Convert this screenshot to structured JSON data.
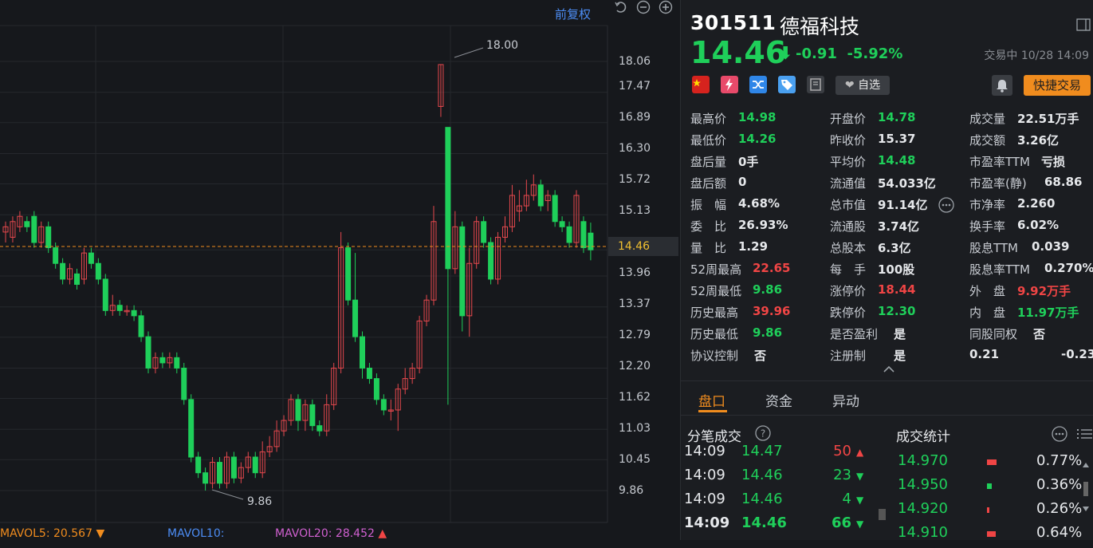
{
  "chart": {
    "restore_label": "前复权",
    "high_tag": "18.00",
    "low_tag": "9.86",
    "price_levels": [
      "18.06",
      "17.47",
      "16.89",
      "16.30",
      "15.72",
      "15.13",
      "14.46",
      "13.96",
      "13.37",
      "12.79",
      "12.20",
      "11.62",
      "11.03",
      "10.45",
      "9.86"
    ],
    "current_price_label": "14.46",
    "mavol": [
      {
        "label": "MAVOL5:",
        "value": "20.567",
        "color": "#f08c1e"
      },
      {
        "label": "MAVOL10:",
        "value": "",
        "color": "#4c8df5"
      },
      {
        "label": "MAVOL20:",
        "value": "28.452",
        "color": "#d060d0"
      }
    ]
  },
  "stock": {
    "code": "301511",
    "name": "德福科技",
    "price": "14.46",
    "change": "-0.91",
    "change_pct": "-5.92%",
    "status": "交易中 10/28 14:09",
    "watchlist_label": "自选",
    "quick_trade_label": "快捷交易"
  },
  "quote_cols": [
    [
      {
        "label": "最高价",
        "value": "14.98",
        "cls": "dn"
      },
      {
        "label": "最低价",
        "value": "14.26",
        "cls": "dn"
      },
      {
        "label": "盘后量",
        "value": "0手",
        "cls": "wh"
      },
      {
        "label": "盘后额",
        "value": "0",
        "cls": "wh"
      },
      {
        "label": "振　幅",
        "value": "4.68%",
        "cls": "wh"
      },
      {
        "label": "委　比",
        "value": "26.93%",
        "cls": "wh"
      },
      {
        "label": "量　比",
        "value": "1.29",
        "cls": "wh"
      },
      {
        "label": "52周最高",
        "value": "22.65",
        "cls": "up"
      },
      {
        "label": "52周最低",
        "value": "9.86",
        "cls": "dn"
      },
      {
        "label": "历史最高",
        "value": "39.96",
        "cls": "up"
      },
      {
        "label": "历史最低",
        "value": "9.86",
        "cls": "dn"
      },
      {
        "label": "协议控制",
        "value": "否",
        "cls": "wh"
      }
    ],
    [
      {
        "label": "开盘价",
        "value": "14.78",
        "cls": "dn"
      },
      {
        "label": "昨收价",
        "value": "15.37",
        "cls": "wh"
      },
      {
        "label": "平均价",
        "value": "14.48",
        "cls": "dn"
      },
      {
        "label": "流通值",
        "value": "54.033亿",
        "cls": "wh"
      },
      {
        "label": "总市值",
        "value": "91.14亿",
        "cls": "wh"
      },
      {
        "label": "流通股",
        "value": "3.74亿",
        "cls": "wh"
      },
      {
        "label": "总股本",
        "value": "6.3亿",
        "cls": "wh"
      },
      {
        "label": "每　手",
        "value": "100股",
        "cls": "wh"
      },
      {
        "label": "涨停价",
        "value": "18.44",
        "cls": "up"
      },
      {
        "label": "跌停价",
        "value": "12.30",
        "cls": "dn"
      },
      {
        "label": "是否盈利",
        "value": "是",
        "cls": "wh"
      },
      {
        "label": "注册制",
        "value": "是",
        "cls": "wh"
      }
    ],
    [
      {
        "label": "成交量",
        "value": "22.51万手",
        "cls": "wh"
      },
      {
        "label": "成交额",
        "value": "3.26亿",
        "cls": "wh"
      },
      {
        "label": "市盈率TTM",
        "value": "亏损",
        "cls": "wh"
      },
      {
        "label": "市盈率(静)",
        "value": "68.86",
        "cls": "wh"
      },
      {
        "label": "市净率",
        "value": "2.260",
        "cls": "wh"
      },
      {
        "label": "换手率",
        "value": "6.02%",
        "cls": "wh"
      },
      {
        "label": "股息TTM",
        "value": "0.039",
        "cls": "wh"
      },
      {
        "label": "股息率TTM",
        "value": "0.270%",
        "cls": "wh"
      },
      {
        "label": "外　盘",
        "value": "9.92万手",
        "cls": "up"
      },
      {
        "label": "内　盘",
        "value": "11.97万手",
        "cls": "dn"
      },
      {
        "label": "同股同权",
        "value": "否",
        "cls": "wh"
      },
      {
        "label": "0.21",
        "value": "-0.23",
        "cls": "wh"
      }
    ]
  ],
  "tabs": [
    "盘口",
    "资金",
    "异动"
  ],
  "tick_title": "分笔成交",
  "stats_title": "成交统计",
  "ticks": [
    {
      "time": "14:09",
      "price": "14.47",
      "vol": "50",
      "dir": "up"
    },
    {
      "time": "14:09",
      "price": "14.46",
      "vol": "23",
      "dir": "dn"
    },
    {
      "time": "14:09",
      "price": "14.46",
      "vol": "4",
      "dir": "dn"
    },
    {
      "time": "14:09",
      "price": "14.46",
      "vol": "66",
      "dir": "dn"
    }
  ],
  "stats": [
    {
      "price": "14.970",
      "pct": "0.77%"
    },
    {
      "price": "14.950",
      "pct": "0.36%"
    },
    {
      "price": "14.920",
      "pct": "0.26%"
    },
    {
      "price": "14.910",
      "pct": "0.64%"
    }
  ]
}
